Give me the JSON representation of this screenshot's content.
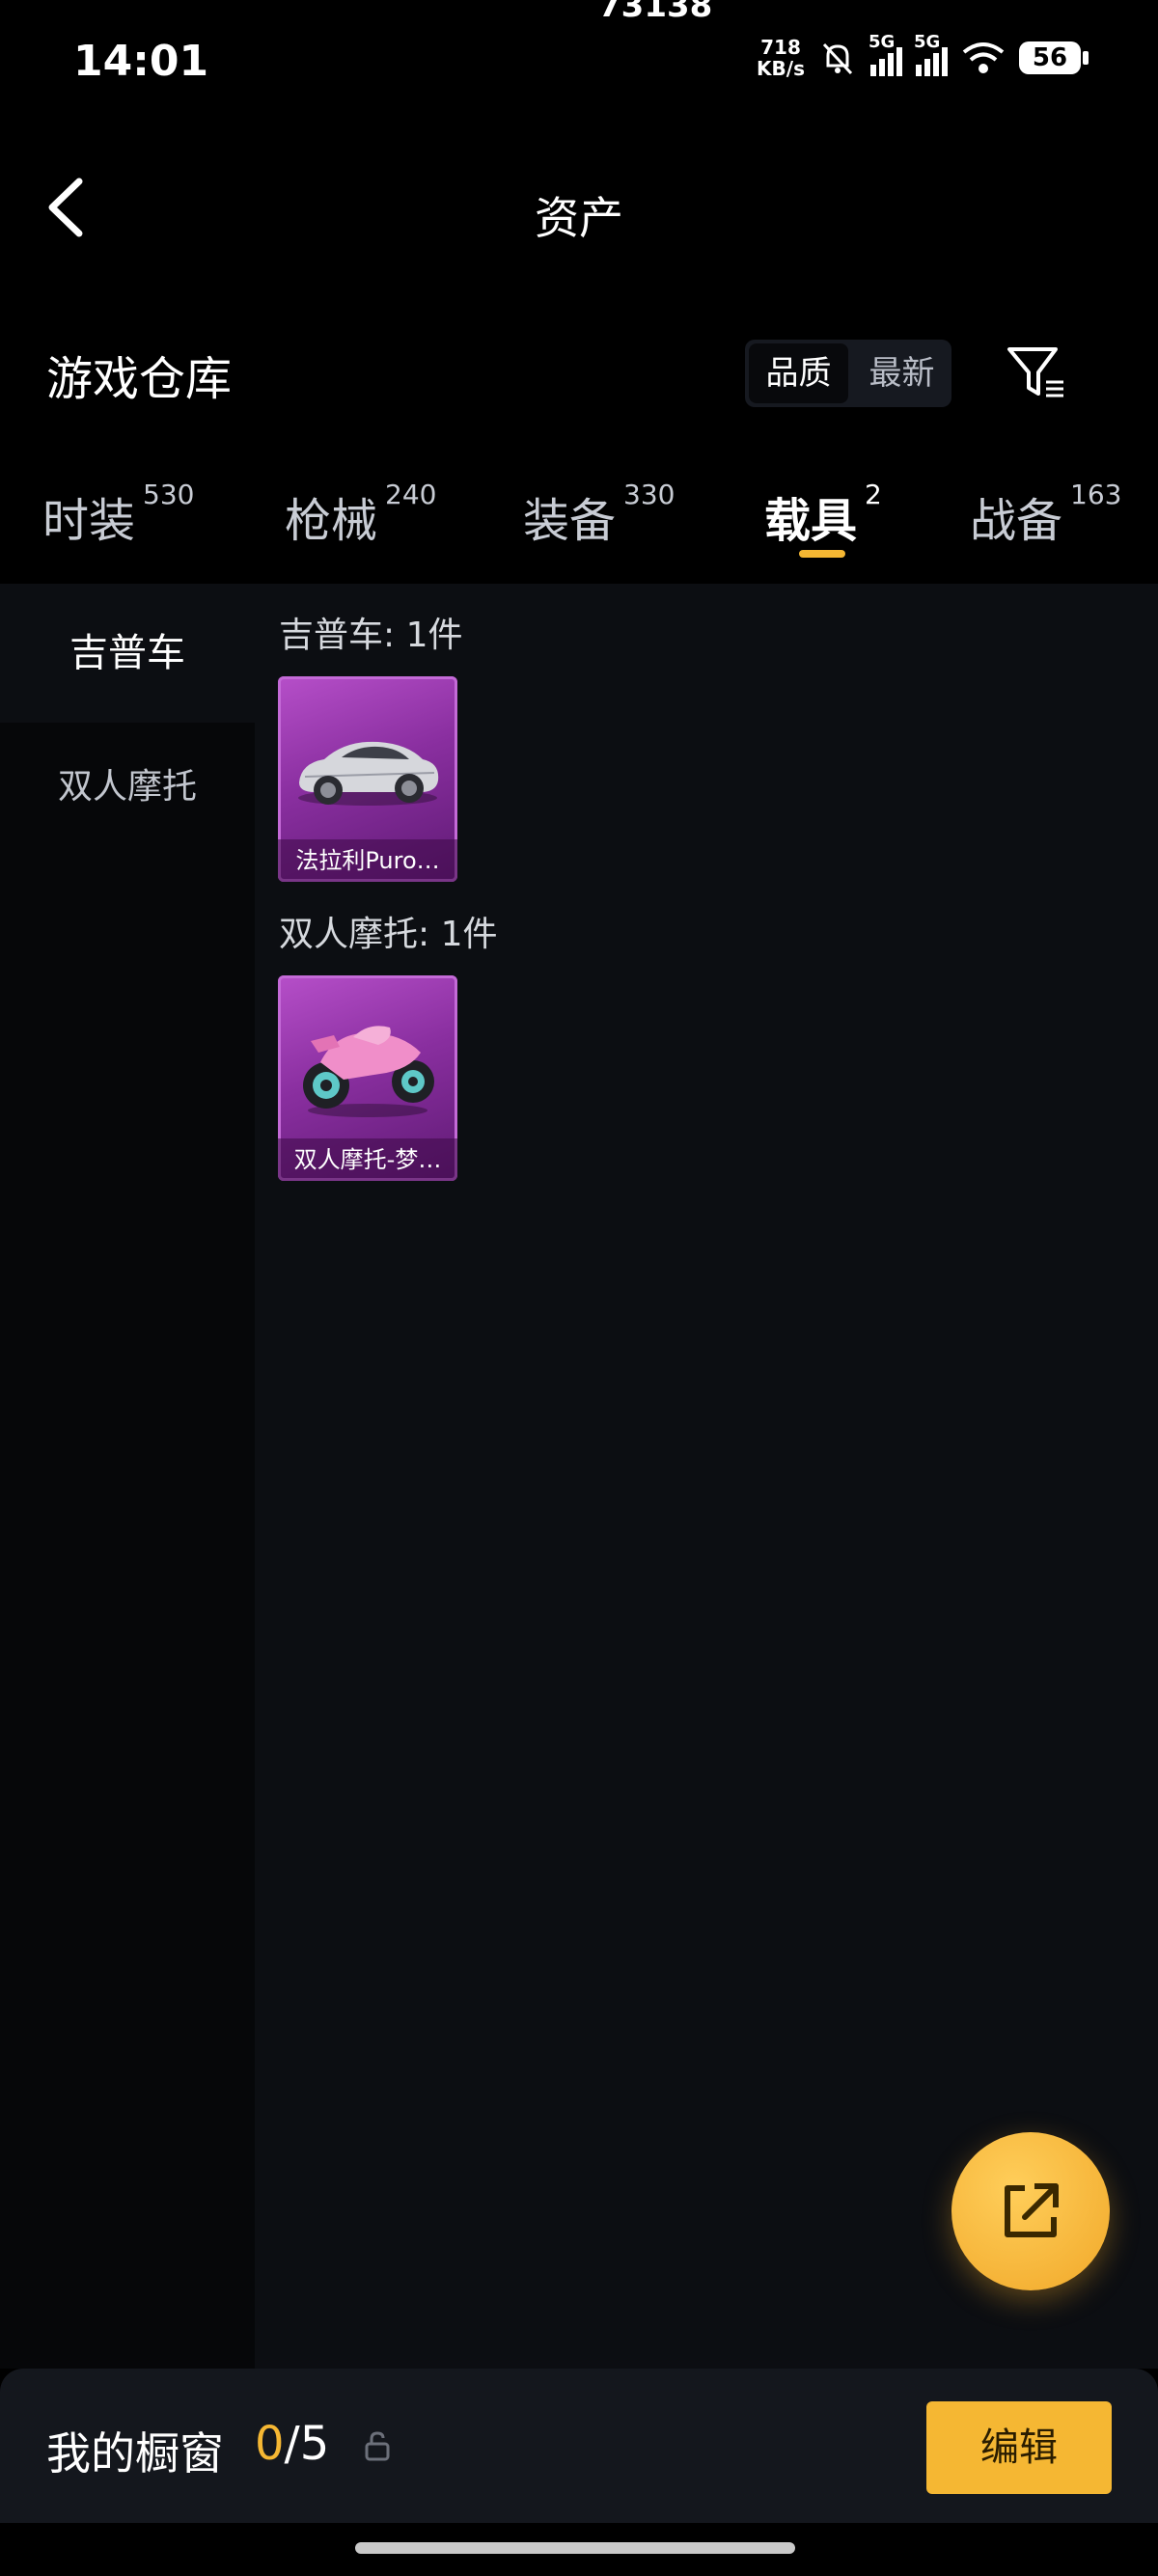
{
  "status_bar": {
    "time": "14:01",
    "top_center": "73138",
    "net_speed_value": "718",
    "net_speed_unit": "KB/s",
    "sim1": "5G",
    "sim2": "5G",
    "battery": "56",
    "icons": [
      "mute-bell-icon",
      "signal-icon",
      "wifi-icon",
      "battery-icon"
    ]
  },
  "nav": {
    "title": "资产",
    "back_icon": "chevron-left-icon"
  },
  "warehouse": {
    "title": "游戏仓库",
    "sort": [
      "品质",
      "最新"
    ],
    "active_sort": "品质",
    "filter_icon": "filter-icon"
  },
  "tabs": [
    {
      "label": "时装",
      "count": "530"
    },
    {
      "label": "枪械",
      "count": "240"
    },
    {
      "label": "装备",
      "count": "330"
    },
    {
      "label": "载具",
      "count": "2",
      "active": true
    },
    {
      "label": "战备",
      "count": "163"
    }
  ],
  "categories": [
    "吉普车",
    "双人摩托"
  ],
  "sections": [
    {
      "title": "吉普车: 1件",
      "items": [
        {
          "name": "法拉利Puro…",
          "icon": "sports-car-image"
        }
      ]
    },
    {
      "title": "双人摩托: 1件",
      "items": [
        {
          "name": "双人摩托-梦…",
          "icon": "motorcycle-image"
        }
      ]
    }
  ],
  "fab": {
    "icon": "share-external-icon"
  },
  "showcase": {
    "label": "我的橱窗",
    "current": "0",
    "total": "/5",
    "lock_icon": "unlock-icon",
    "edit_label": "编辑"
  },
  "colors": {
    "accent": "#f5b733",
    "card": "#9b38b3",
    "background": "#000000",
    "panel": "#0c0e12"
  }
}
